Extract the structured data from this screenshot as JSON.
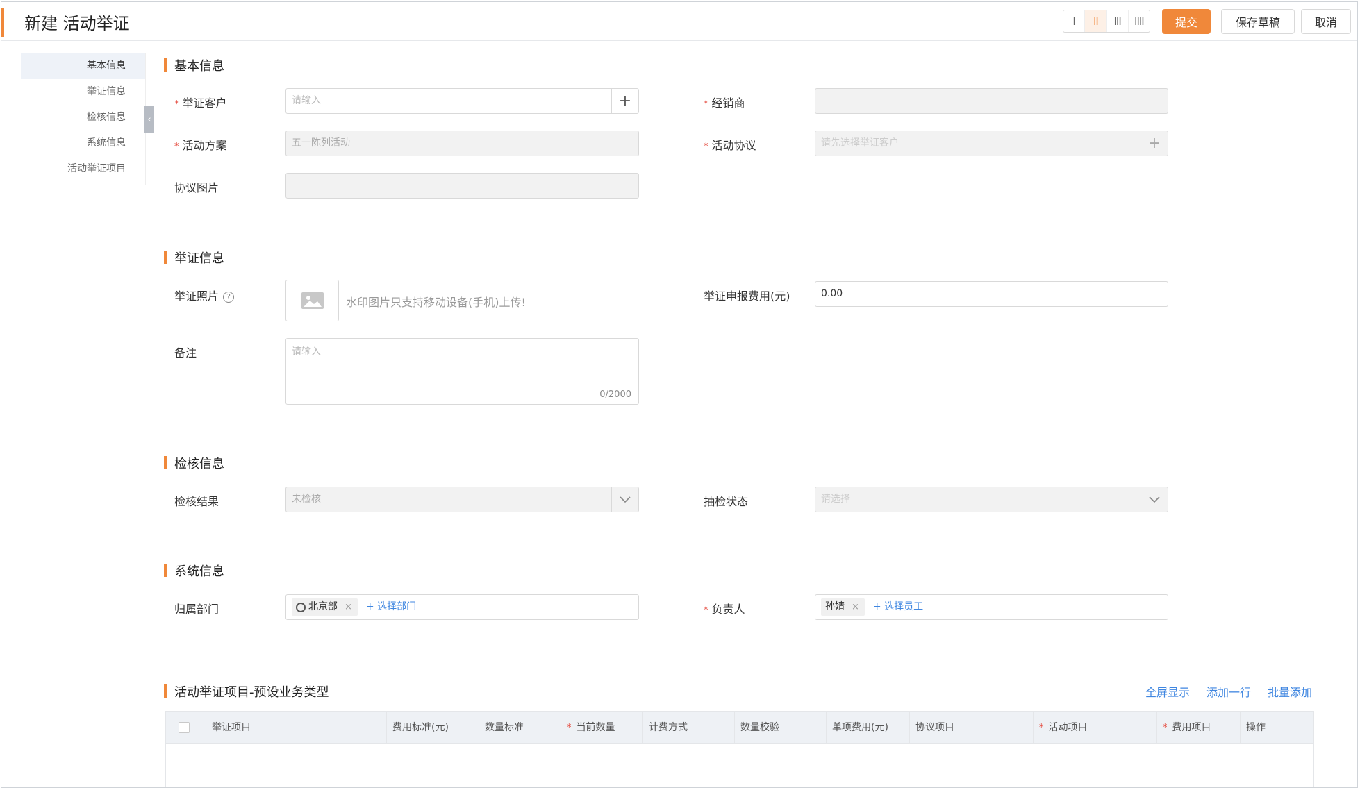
{
  "header": {
    "title": "新建 活动举证",
    "layout_options": [
      "I",
      "II",
      "III",
      "IIII"
    ],
    "submit_label": "提交",
    "save_draft_label": "保存草稿",
    "cancel_label": "取消"
  },
  "nav": {
    "items": [
      {
        "label": "基本信息"
      },
      {
        "label": "举证信息"
      },
      {
        "label": "检核信息"
      },
      {
        "label": "系统信息"
      },
      {
        "label": "活动举证项目"
      }
    ],
    "collapse_icon": "‹"
  },
  "basic": {
    "title": "基本信息",
    "customer_label": "举证客户",
    "customer_placeholder": "请输入",
    "dealer_label": "经销商",
    "plan_label": "活动方案",
    "plan_value": "五一陈列活动",
    "agreement_label": "活动协议",
    "agreement_placeholder": "请先选择举证客户",
    "agreement_image_label": "协议图片"
  },
  "evidence": {
    "title": "举证信息",
    "photo_label": "举证照片",
    "upload_tip": "水印图片只支持移动设备(手机)上传!",
    "fee_label": "举证申报费用(元)",
    "fee_value": "0.00",
    "remark_label": "备注",
    "remark_placeholder": "请输入",
    "remark_counter": "0/2000"
  },
  "inspection": {
    "title": "检核信息",
    "result_label": "检核结果",
    "result_value": "未检核",
    "spot_label": "抽检状态",
    "spot_placeholder": "请选择"
  },
  "system": {
    "title": "系统信息",
    "dept_label": "归属部门",
    "dept_tag": "北京部",
    "dept_add": "+ 选择部门",
    "owner_label": "负责人",
    "owner_tag": "孙婧",
    "owner_add": "+ 选择员工"
  },
  "items_table": {
    "title": "活动举证项目-预设业务类型",
    "actions": [
      "全屏显示",
      "添加一行",
      "批量添加"
    ],
    "columns": [
      {
        "label": "举证项目",
        "required": false
      },
      {
        "label": "费用标准(元)",
        "required": false
      },
      {
        "label": "数量标准",
        "required": false
      },
      {
        "label": "当前数量",
        "required": true
      },
      {
        "label": "计费方式",
        "required": false
      },
      {
        "label": "数量校验",
        "required": false
      },
      {
        "label": "单项费用(元)",
        "required": false
      },
      {
        "label": "协议项目",
        "required": false
      },
      {
        "label": "活动项目",
        "required": true
      },
      {
        "label": "费用项目",
        "required": true
      },
      {
        "label": "操作",
        "required": false
      }
    ]
  },
  "colors": {
    "accent": "#f0883a",
    "link": "#3f86e0",
    "required": "#e5473b"
  }
}
